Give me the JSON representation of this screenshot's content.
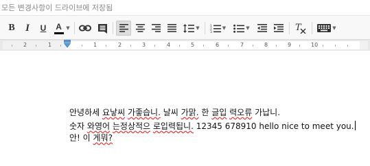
{
  "status": {
    "save_message": "모든 변경사항이 드라이브에 저장됨"
  },
  "toolbar": {
    "bold_label": "B",
    "italic_label": "I",
    "underline_label": "U",
    "text_color_label": "A",
    "text_color": "#000000",
    "buttons": [
      {
        "name": "bold",
        "icon": "bold-icon"
      },
      {
        "name": "italic",
        "icon": "italic-icon"
      },
      {
        "name": "underline",
        "icon": "underline-icon"
      },
      {
        "name": "text-color",
        "icon": "text-color-icon"
      },
      {
        "name": "link",
        "icon": "link-icon"
      },
      {
        "name": "comment",
        "icon": "comment-icon"
      },
      {
        "name": "align-left",
        "icon": "align-left-icon",
        "active": true
      },
      {
        "name": "align-center",
        "icon": "align-center-icon"
      },
      {
        "name": "align-right",
        "icon": "align-right-icon"
      },
      {
        "name": "justify",
        "icon": "justify-icon"
      },
      {
        "name": "line-spacing",
        "icon": "line-spacing-icon"
      },
      {
        "name": "numbered-list",
        "icon": "numbered-list-icon"
      },
      {
        "name": "bulleted-list",
        "icon": "bulleted-list-icon"
      },
      {
        "name": "decrease-indent",
        "icon": "decrease-indent-icon"
      },
      {
        "name": "increase-indent",
        "icon": "increase-indent-icon"
      },
      {
        "name": "clear-formatting",
        "icon": "clear-formatting-icon"
      },
      {
        "name": "input-tools",
        "icon": "keyboard-icon"
      }
    ]
  },
  "ruler": {
    "numbers": [
      "2",
      "1",
      "1",
      "2",
      "3",
      "4",
      "5",
      "6",
      "7",
      "8",
      "9",
      "10"
    ]
  },
  "document": {
    "line1": {
      "s1": "안녕하세 ",
      "s2": "요낳씨",
      "s3": " ",
      "s4": "가좋습니.",
      "s5": " 날씨 ",
      "s6": "가맑.",
      "s7": " 한 ",
      "s8": "글입",
      "s9": " ",
      "s10": "력오류",
      "s11": " 가납니."
    },
    "line2": {
      "s1": "숫자 ",
      "s2": "와영어",
      "s3": " ",
      "s4": "는정상적으",
      "s5": " ",
      "s6": "로입력됩니.",
      "s7": " 12345 678910 hello nice to meet you."
    },
    "line3": {
      "s1": "안! 이 ",
      "s2": "게뭐?"
    }
  },
  "colors": {
    "spellcheck": "#e53935",
    "toolbar_bg": "#f8f8f8",
    "ruler_bg": "#e8e8e8",
    "indent_marker": "#4a90d9"
  }
}
